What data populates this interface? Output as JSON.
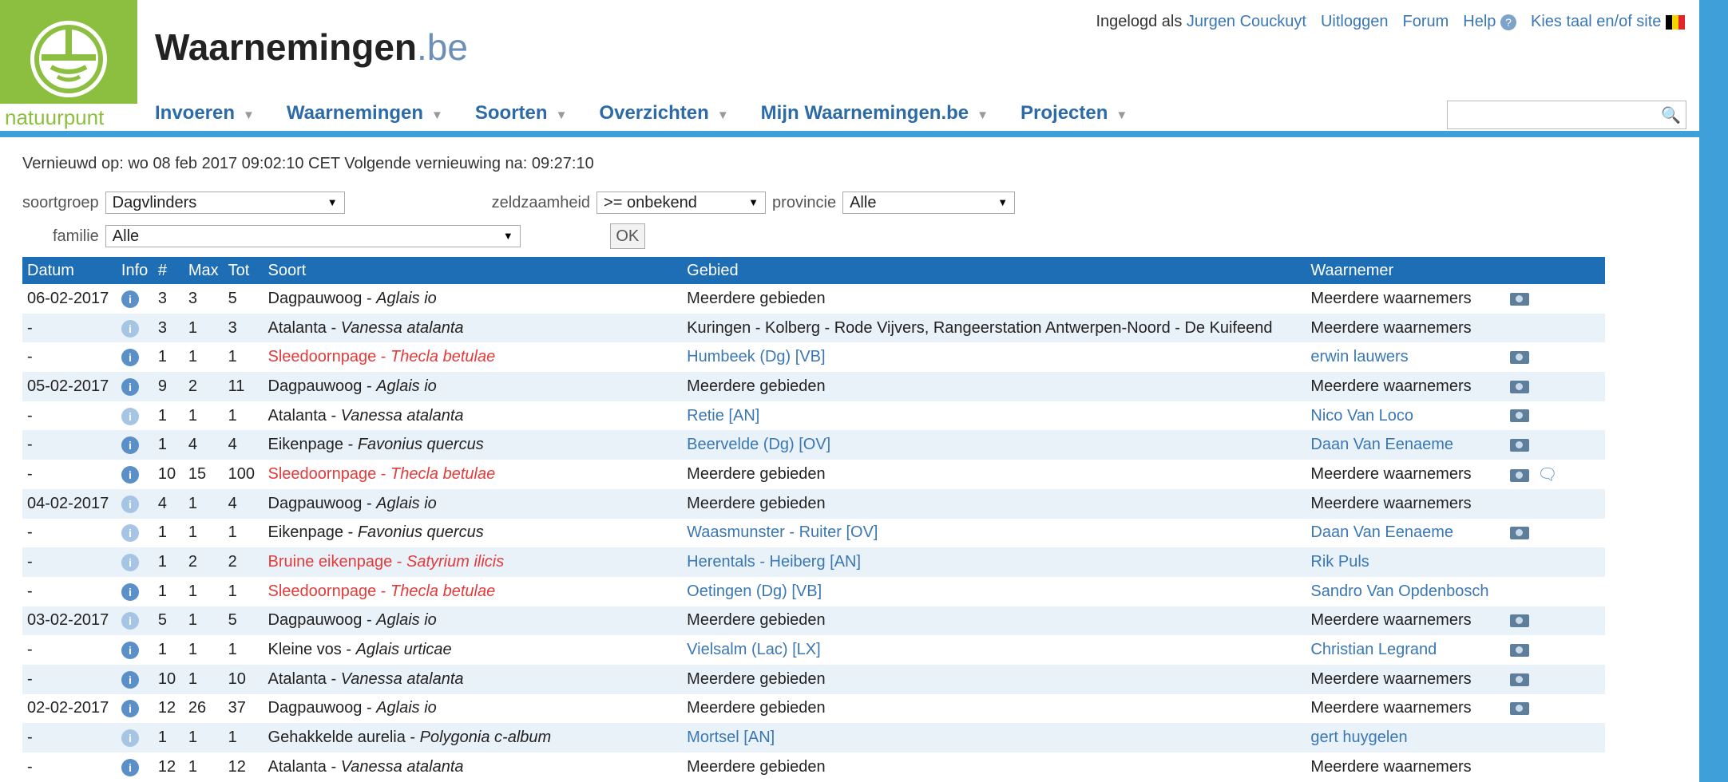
{
  "header": {
    "logo_text": "natuurpunt",
    "site_title": "Waarnemingen",
    "site_tld": ".be",
    "top_links": {
      "logged_in_prefix": "Ingelogd als",
      "user": "Jurgen Couckuyt",
      "logout": "Uitloggen",
      "forum": "Forum",
      "help": "Help",
      "language": "Kies taal en/of site"
    },
    "nav": [
      "Invoeren",
      "Waarnemingen",
      "Soorten",
      "Overzichten",
      "Mijn Waarnemingen.be",
      "Projecten"
    ],
    "search": {
      "placeholder": ""
    }
  },
  "refresh_text": "Vernieuwd op: wo 08 feb 2017 09:02:10 CET Volgende vernieuwing na: 09:27:10",
  "filters": {
    "soortgroep_label": "soortgroep",
    "soortgroep_value": "Dagvlinders",
    "zeldzaamheid_label": "zeldzaamheid",
    "zeldzaamheid_value": ">= onbekend",
    "provincie_label": "provincie",
    "provincie_value": "Alle",
    "familie_label": "familie",
    "familie_value": "Alle",
    "ok_label": "OK"
  },
  "table": {
    "headers": [
      "Datum",
      "Info",
      "#",
      "Max",
      "Tot",
      "Soort",
      "Gebied",
      "Waarnemer"
    ],
    "rows": [
      {
        "date": "06-02-2017",
        "n": "3",
        "max": "3",
        "tot": "5",
        "name": "Dagpauwoog",
        "sci": "Aglais io",
        "rare": false,
        "area": "Meerdere gebieden",
        "area_link": false,
        "observer": "Meerdere waarnemers",
        "obs_link": false,
        "info_light": false,
        "camera": true,
        "comment": false
      },
      {
        "date": "-",
        "n": "3",
        "max": "1",
        "tot": "3",
        "name": "Atalanta",
        "sci": "Vanessa atalanta",
        "rare": false,
        "area": "Kuringen - Kolberg - Rode Vijvers, Rangeerstation Antwerpen-Noord - De Kuifeend",
        "area_link": false,
        "observer": "Meerdere waarnemers",
        "obs_link": false,
        "info_light": true,
        "camera": false,
        "comment": false
      },
      {
        "date": "-",
        "n": "1",
        "max": "1",
        "tot": "1",
        "name": "Sleedoornpage",
        "sci": "Thecla betulae",
        "rare": true,
        "area": "Humbeek (Dg) [VB]",
        "area_link": true,
        "observer": "erwin lauwers",
        "obs_link": true,
        "info_light": false,
        "camera": true,
        "comment": false
      },
      {
        "date": "05-02-2017",
        "n": "9",
        "max": "2",
        "tot": "11",
        "name": "Dagpauwoog",
        "sci": "Aglais io",
        "rare": false,
        "area": "Meerdere gebieden",
        "area_link": false,
        "observer": "Meerdere waarnemers",
        "obs_link": false,
        "info_light": false,
        "camera": true,
        "comment": false
      },
      {
        "date": "-",
        "n": "1",
        "max": "1",
        "tot": "1",
        "name": "Atalanta",
        "sci": "Vanessa atalanta",
        "rare": false,
        "area": "Retie [AN]",
        "area_link": true,
        "observer": "Nico Van Loco",
        "obs_link": true,
        "info_light": true,
        "camera": true,
        "comment": false
      },
      {
        "date": "-",
        "n": "1",
        "max": "4",
        "tot": "4",
        "name": "Eikenpage",
        "sci": "Favonius quercus",
        "rare": false,
        "area": "Beervelde (Dg) [OV]",
        "area_link": true,
        "observer": "Daan Van Eenaeme",
        "obs_link": true,
        "info_light": false,
        "camera": true,
        "comment": false
      },
      {
        "date": "-",
        "n": "10",
        "max": "15",
        "tot": "100",
        "name": "Sleedoornpage",
        "sci": "Thecla betulae",
        "rare": true,
        "area": "Meerdere gebieden",
        "area_link": false,
        "observer": "Meerdere waarnemers",
        "obs_link": false,
        "info_light": false,
        "camera": true,
        "comment": true
      },
      {
        "date": "04-02-2017",
        "n": "4",
        "max": "1",
        "tot": "4",
        "name": "Dagpauwoog",
        "sci": "Aglais io",
        "rare": false,
        "area": "Meerdere gebieden",
        "area_link": false,
        "observer": "Meerdere waarnemers",
        "obs_link": false,
        "info_light": true,
        "camera": false,
        "comment": false
      },
      {
        "date": "-",
        "n": "1",
        "max": "1",
        "tot": "1",
        "name": "Eikenpage",
        "sci": "Favonius quercus",
        "rare": false,
        "area": "Waasmunster - Ruiter [OV]",
        "area_link": true,
        "observer": "Daan Van Eenaeme",
        "obs_link": true,
        "info_light": true,
        "camera": true,
        "comment": false
      },
      {
        "date": "-",
        "n": "1",
        "max": "2",
        "tot": "2",
        "name": "Bruine eikenpage",
        "sci": "Satyrium ilicis",
        "rare": true,
        "area": "Herentals - Heiberg [AN]",
        "area_link": true,
        "observer": "Rik Puls",
        "obs_link": true,
        "info_light": true,
        "camera": false,
        "comment": false
      },
      {
        "date": "-",
        "n": "1",
        "max": "1",
        "tot": "1",
        "name": "Sleedoornpage",
        "sci": "Thecla betulae",
        "rare": true,
        "area": "Oetingen (Dg) [VB]",
        "area_link": true,
        "observer": "Sandro Van Opdenbosch",
        "obs_link": true,
        "info_light": false,
        "camera": false,
        "comment": false
      },
      {
        "date": "03-02-2017",
        "n": "5",
        "max": "1",
        "tot": "5",
        "name": "Dagpauwoog",
        "sci": "Aglais io",
        "rare": false,
        "area": "Meerdere gebieden",
        "area_link": false,
        "observer": "Meerdere waarnemers",
        "obs_link": false,
        "info_light": true,
        "camera": true,
        "comment": false
      },
      {
        "date": "-",
        "n": "1",
        "max": "1",
        "tot": "1",
        "name": "Kleine vos",
        "sci": "Aglais urticae",
        "rare": false,
        "area": "Vielsalm (Lac) [LX]",
        "area_link": true,
        "observer": "Christian Legrand",
        "obs_link": true,
        "info_light": false,
        "camera": true,
        "comment": false
      },
      {
        "date": "-",
        "n": "10",
        "max": "1",
        "tot": "10",
        "name": "Atalanta",
        "sci": "Vanessa atalanta",
        "rare": false,
        "area": "Meerdere gebieden",
        "area_link": false,
        "observer": "Meerdere waarnemers",
        "obs_link": false,
        "info_light": false,
        "camera": true,
        "comment": false
      },
      {
        "date": "02-02-2017",
        "n": "12",
        "max": "26",
        "tot": "37",
        "name": "Dagpauwoog",
        "sci": "Aglais io",
        "rare": false,
        "area": "Meerdere gebieden",
        "area_link": false,
        "observer": "Meerdere waarnemers",
        "obs_link": false,
        "info_light": false,
        "camera": true,
        "comment": false
      },
      {
        "date": "-",
        "n": "1",
        "max": "1",
        "tot": "1",
        "name": "Gehakkelde aurelia",
        "sci": "Polygonia c-album",
        "rare": false,
        "area": "Mortsel [AN]",
        "area_link": true,
        "observer": "gert huygelen",
        "obs_link": true,
        "info_light": true,
        "camera": false,
        "comment": false
      },
      {
        "date": "-",
        "n": "12",
        "max": "1",
        "tot": "12",
        "name": "Atalanta",
        "sci": "Vanessa atalanta",
        "rare": false,
        "area": "Meerdere gebieden",
        "area_link": false,
        "observer": "Meerdere waarnemers",
        "obs_link": false,
        "info_light": false,
        "camera": false,
        "comment": false
      }
    ]
  },
  "colors": {
    "header_bg": "#1e6eb5",
    "rare_text": "#e53a3a",
    "link_text": "#3a77b5",
    "logo_green": "#8cbf3f"
  }
}
